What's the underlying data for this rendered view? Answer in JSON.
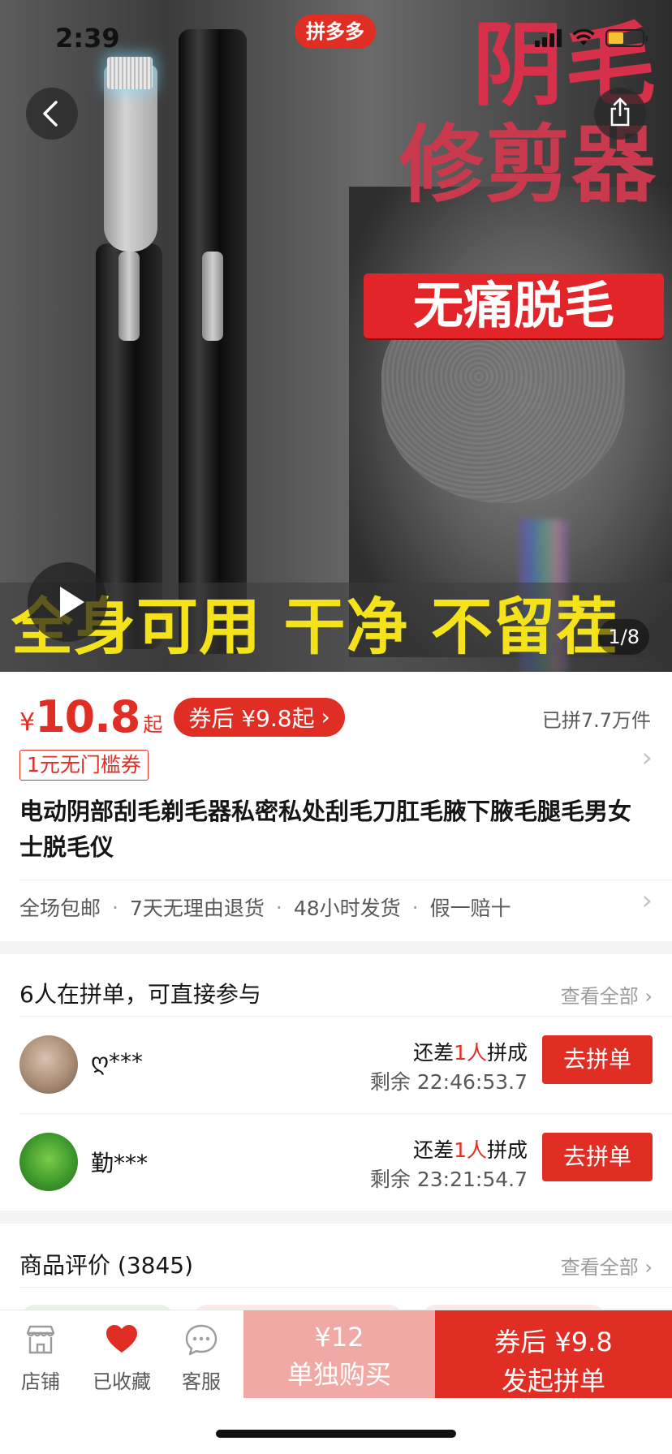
{
  "status_bar": {
    "time": "2:39",
    "battery_color": "#f4c430"
  },
  "hero": {
    "brand_badge": "拼多多",
    "title_line1": "阴毛",
    "title_line2": "修剪器",
    "tag": "无痛脱毛",
    "slogan": "全身可用 干净 不留茬",
    "page_indicator": "1/8",
    "back_icon": "chevron-left-icon",
    "share_icon": "share-icon",
    "play_icon": "play-icon"
  },
  "product": {
    "price_symbol": "¥",
    "price": "10.8",
    "price_suffix": "起",
    "coupon_pill": "券后 ¥9.8起",
    "sold": "已拼7.7万件",
    "coupon_tag": "1元无门槛券",
    "title": "电动阴部刮毛剃毛器私密私处刮毛刀肛毛腋下腋毛腿毛男女士脱毛仪",
    "services": [
      "全场包邮",
      "7天无理由退货",
      "48小时发货",
      "假一赔十"
    ]
  },
  "group_buy": {
    "title": "6人在拼单，可直接参与",
    "see_all": "查看全部",
    "rows": [
      {
        "name": "ღ***",
        "need_prefix": "还差",
        "need_count": "1人",
        "need_suffix": "拼成",
        "remaining": "剩余 22:46:53.7",
        "button": "去拼单"
      },
      {
        "name": "勤***",
        "need_prefix": "还差",
        "need_count": "1人",
        "need_suffix": "拼成",
        "remaining": "剩余 23:21:54.7",
        "button": "去拼单"
      }
    ]
  },
  "reviews": {
    "title": "商品评价 (3845)",
    "see_all": "查看全部"
  },
  "bottom_bar": {
    "store": "店铺",
    "favorited": "已收藏",
    "service": "客服",
    "buy_alone_price": "¥12",
    "buy_alone_label": "单独购买",
    "buy_group_price": "券后 ¥9.8",
    "buy_group_label": "发起拼单"
  },
  "colors": {
    "accent": "#e02e24",
    "accent_light": "#f1a9a5"
  }
}
